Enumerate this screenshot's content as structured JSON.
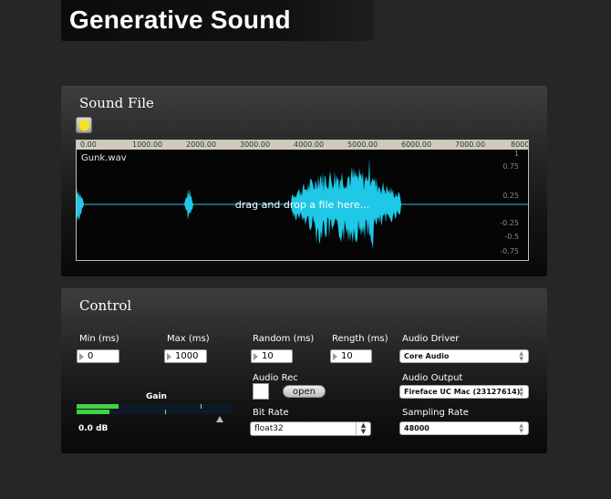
{
  "app": {
    "title": "Generative Sound"
  },
  "sound_file": {
    "title": "Sound File",
    "file_name": "Gunk.wav",
    "drop_hint": "drag and drop a file here...",
    "ruler_ticks": [
      "0.00",
      "1000.00",
      "2000.00",
      "3000.00",
      "4000.00",
      "5000.00",
      "6000.00",
      "7000.00",
      "8000"
    ],
    "amplitude_labels": [
      "1",
      "0.75",
      "0.25",
      "-0.25",
      "-0.5",
      "-0.75"
    ],
    "waveform_color": "#1ec8e6",
    "indicator_color": "#f5e51a"
  },
  "control": {
    "title": "Control",
    "min": {
      "label": "Min (ms)",
      "value": "0"
    },
    "max": {
      "label": "Max (ms)",
      "value": "1000"
    },
    "random": {
      "label": "Random (ms)",
      "value": "10"
    },
    "length": {
      "label": "Rength (ms)",
      "value": "10"
    },
    "audio_driver": {
      "label": "Audio Driver",
      "value": "Core Audio"
    },
    "audio_output": {
      "label": "Audio Output",
      "value": "Fireface UC Mac (23127614)"
    },
    "sampling_rate": {
      "label": "Sampling Rate",
      "value": "48000"
    },
    "audio_rec": {
      "label": "Audio Rec",
      "open_label": "open"
    },
    "bit_rate": {
      "label": "Bit Rate",
      "value": "float32"
    },
    "gain": {
      "label": "Gain",
      "db": "0.0 dB",
      "meter_left": 0.27,
      "meter_right": 0.21,
      "meter_color": "#3fd34a"
    }
  }
}
